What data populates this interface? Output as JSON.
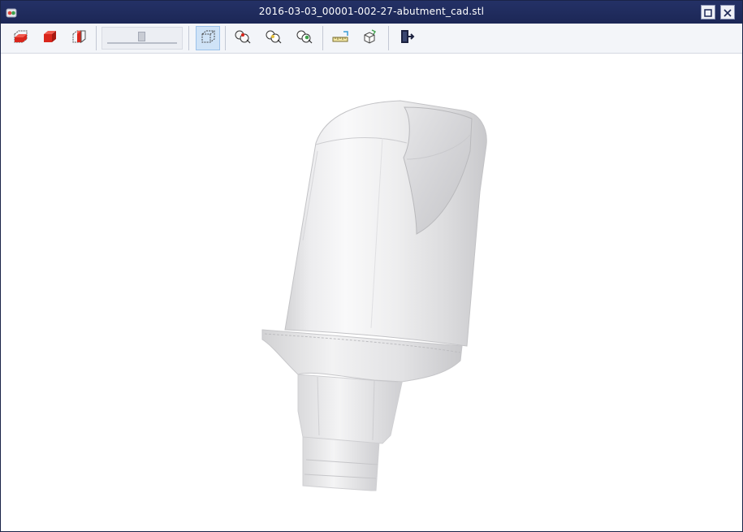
{
  "window": {
    "title": "2016-03-03_00001-002-27-abutment_cad.stl",
    "icon": "app-icon",
    "maximize_icon": "maximize-icon",
    "close_icon": "close-icon"
  },
  "toolbar": {
    "buttons": [
      {
        "id": "view-bottom",
        "icon": "box-bottom-face-icon"
      },
      {
        "id": "view-solid",
        "icon": "solid-box-icon"
      },
      {
        "id": "view-side",
        "icon": "box-side-face-icon"
      },
      {
        "id": "view-wireframe",
        "icon": "dashed-box-icon",
        "active": true
      },
      {
        "id": "view-shading-1",
        "icon": "spheres-icon"
      },
      {
        "id": "view-shading-2",
        "icon": "spheres-outline-icon"
      },
      {
        "id": "view-shading-3",
        "icon": "spheres-green-icon"
      },
      {
        "id": "measure",
        "icon": "ruler-icon"
      },
      {
        "id": "rotate",
        "icon": "rotate-cube-icon"
      },
      {
        "id": "exit",
        "icon": "exit-door-icon"
      }
    ],
    "slider_level": 0.48
  },
  "colors": {
    "titlebar": "#1f2a55",
    "toolbar": "#f3f5f9",
    "active_button": "#cfe3f7",
    "icon_red": "#d9261c"
  }
}
